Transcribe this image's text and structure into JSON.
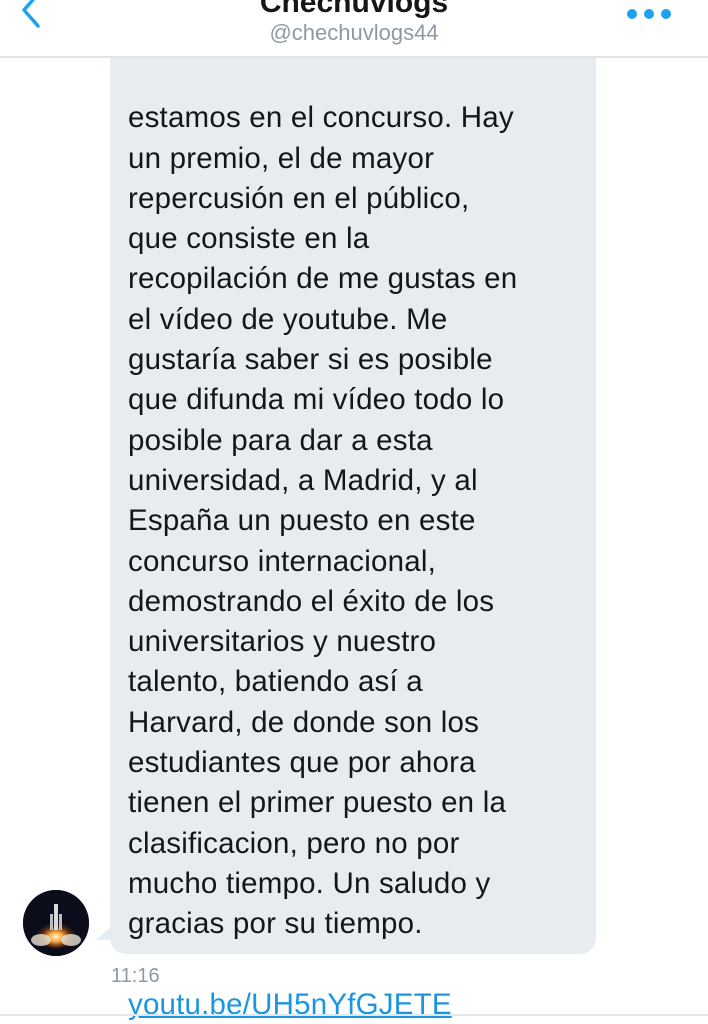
{
  "header": {
    "title": "Chechuvlogs",
    "handle": "@chechuvlogs44",
    "back_icon": "chevron-left-icon",
    "more_icon": "more-dots-icon"
  },
  "message": {
    "lines": [
      "estamos en el concurso. Hay",
      "un premio, el de mayor",
      "repercusión en el público,",
      "que consiste en la",
      "recopilación de me gustas en",
      "el vídeo de youtube. Me",
      "gustaría saber si es posible",
      "que difunda mi vídeo todo lo",
      "posible para dar a esta",
      "universidad, a Madrid, y al",
      "España un puesto en este",
      "concurso internacional,",
      "demostrando el éxito de los",
      "universitarios y nuestro",
      "talento, batiendo así a",
      "Harvard, de donde son los",
      "estudiantes que por ahora",
      "tienen el primer puesto en la",
      "clasificacion, pero no por",
      "mucho tiempo. Un saludo y",
      "gracias por su tiempo."
    ],
    "link": "youtu.be/UH5nYfGJETE",
    "timestamp": "11:16"
  },
  "colors": {
    "accent": "#1da1f2",
    "bubble": "#e6ecf0",
    "text": "#14171a",
    "secondary_text": "#8e99a4",
    "link": "#1b95e0"
  }
}
